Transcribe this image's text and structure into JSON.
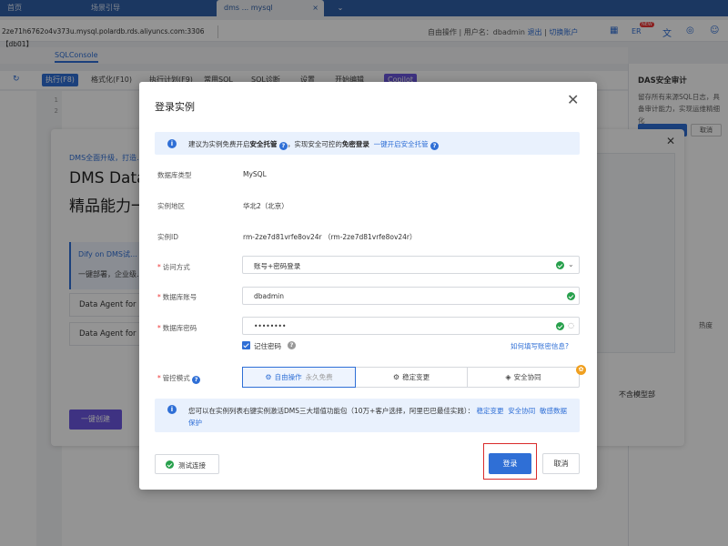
{
  "browser_tabs": [
    {
      "label": "首页"
    },
    {
      "label": "场景引导"
    },
    {
      "label": "dms ... mysql"
    }
  ],
  "connection": "2ze71h6762o4v373u.mysql.polardb.rds.aliyuncs.com:3306 【db01】",
  "account": {
    "label": "自由操作 | 用户名：",
    "username": "dbadmin",
    "logout": "退出",
    "switch": "切换账户",
    "er": "ER",
    "badge": "NEW"
  },
  "sql_tab": "SQLConsole",
  "toolbar": {
    "run": "执行(F8)",
    "format": "格式化(F10)",
    "plan": "执行计划(F9)",
    "common_sql": "常用SQL",
    "sql_diag": "SQL诊断",
    "settings": "设置",
    "open_table": "开始编辑",
    "copilot": "Copilot"
  },
  "editor_lines": [
    "1",
    "2"
  ],
  "right_panel": {
    "title": "DAS安全审计",
    "desc": "留存所有来源SQL日志，具备审计能力，实现运维精细化",
    "btn_primary": "",
    "btn_cancel": "取消",
    "side_text": "热度",
    "side_text2": "不含模型部"
  },
  "promo": {
    "small": "DMS全面升级，打造…",
    "headline1": "DMS Data-",
    "headline2": "精品能力一",
    "card_title": "Dify on DMS试…",
    "card_desc": "一键部署，企业级…",
    "item1": "Data Agent for",
    "item2": "Data Agent for",
    "cta": "一键创建"
  },
  "dialog": {
    "title": "登录实例",
    "notice": {
      "pre": "建议为实例免费开启",
      "bold1": "安全托管",
      "mid": "，实现安全可控的",
      "bold2": "免密登录",
      "link": "一键开启安全托管"
    },
    "db_type_label": "数据库类型",
    "db_type": "MySQL",
    "region_label": "实例地区",
    "region": "华北2（北京）",
    "instance_id_label": "实例ID",
    "instance_id": "rm-2ze7d81vrfe8ov24r （rm-2ze7d81vrfe8ov24r）",
    "access_label": "访问方式",
    "access_value": "账号+密码登录",
    "account_label": "数据库账号",
    "account_value": "dbadmin",
    "password_label": "数据库密码",
    "password_value": "••••••••",
    "remember": "记住密码",
    "howto": "如何填写账密信息?",
    "mode_label": "管控模式",
    "modes": [
      {
        "label": "自由操作",
        "sub": "永久免费"
      },
      {
        "label": "稳定变更",
        "sub": ""
      },
      {
        "label": "安全协同",
        "sub": ""
      }
    ],
    "tip": {
      "text": "您可以在实例列表右键实例激活DMS三大增值功能包（10万+客户选择，阿里巴巴最佳实践）：",
      "link1": "稳定变更",
      "link2": "安全协同",
      "link3": "敏感数据保护"
    },
    "test_btn": "测试连接",
    "login_btn": "登录",
    "cancel_btn": "取消"
  },
  "colors": {
    "accent": "#2f6fd6",
    "highlight": "#d92b2b",
    "success": "#27a04c",
    "copilot": "#6b57e0"
  }
}
